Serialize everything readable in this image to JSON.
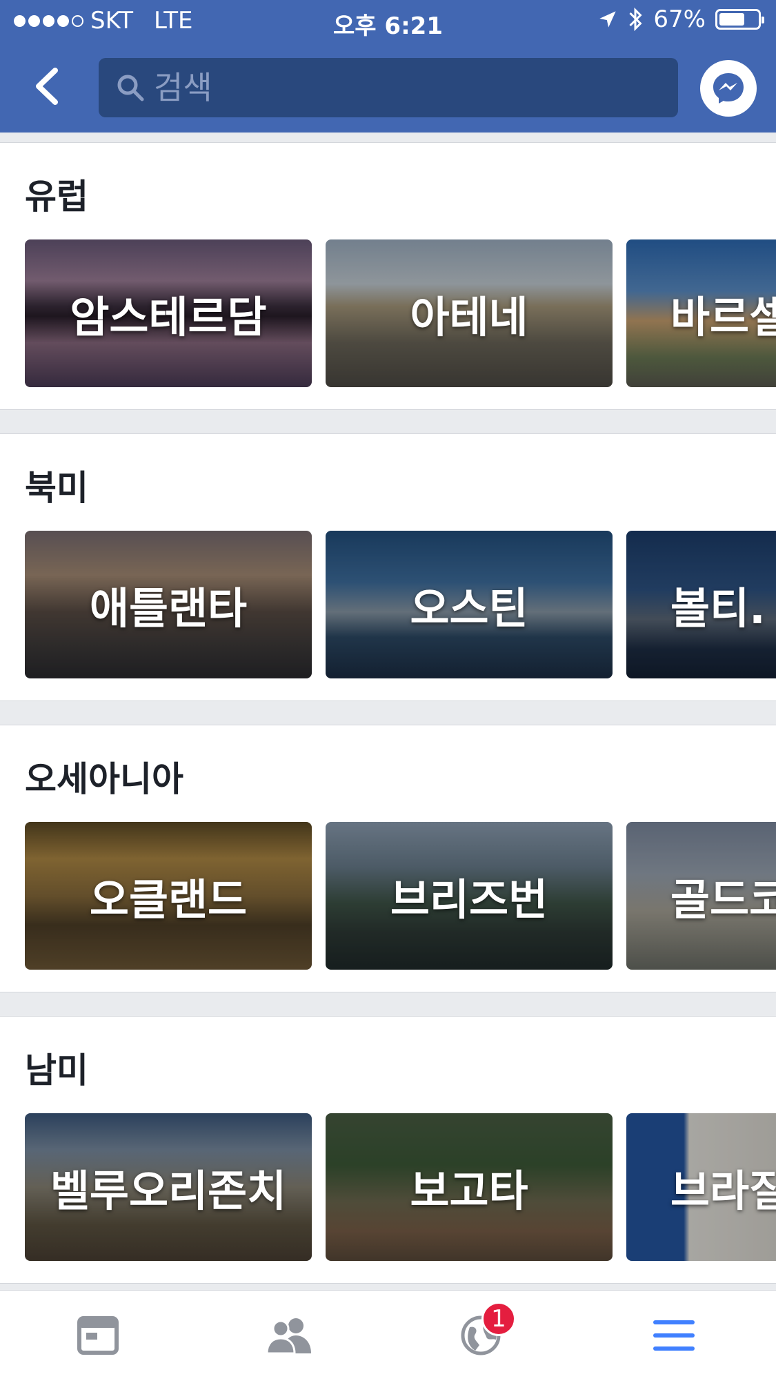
{
  "status_bar": {
    "carrier": "SKT",
    "network": "LTE",
    "time": "오후 6:21",
    "battery_percent": "67%",
    "battery_level": 0.67,
    "signal_bars": 4
  },
  "nav": {
    "search_placeholder": "검색"
  },
  "sections": [
    {
      "title": "유럽",
      "cards": [
        "암스테르담",
        "아테네",
        "바르셀"
      ]
    },
    {
      "title": "북미",
      "cards": [
        "애틀랜타",
        "오스틴",
        "볼티."
      ]
    },
    {
      "title": "오세아니아",
      "cards": [
        "오클랜드",
        "브리즈번",
        "골드코"
      ]
    },
    {
      "title": "남미",
      "cards": [
        "벨루오리존치",
        "보고타",
        "브라질"
      ]
    }
  ],
  "tabbar": {
    "notification_badge": "1",
    "active_tab": "menu"
  },
  "colors": {
    "brand_blue": "#4267b2",
    "search_bg": "#29487d",
    "badge_red": "#e41e3f",
    "tab_inactive": "#90949c",
    "tab_active": "#4080ff"
  }
}
